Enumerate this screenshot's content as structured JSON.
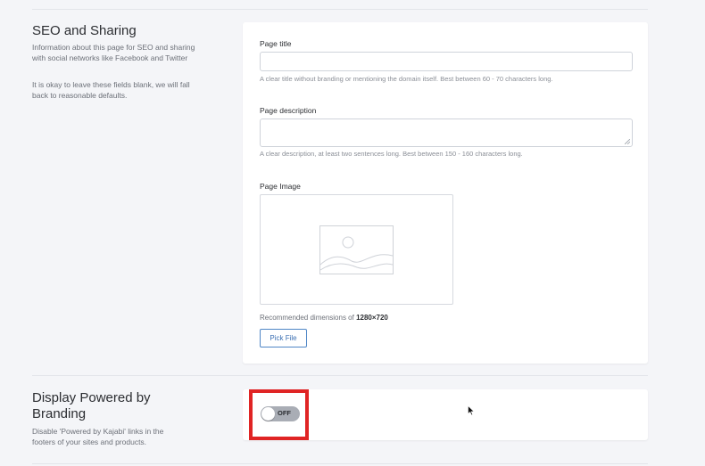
{
  "seo": {
    "title": "SEO and Sharing",
    "desc1": "Information about this page for SEO and sharing with social networks like Facebook and Twitter",
    "desc2": "It is okay to leave these fields blank, we will fall back to reasonable defaults.",
    "page_title_label": "Page title",
    "page_title_value": "",
    "page_title_help": "A clear title without branding or mentioning the domain itself. Best between 60 - 70 characters long.",
    "page_desc_label": "Page description",
    "page_desc_value": "",
    "page_desc_help": "A clear description, at least two sentences long. Best between 150 - 160 characters long.",
    "page_image_label": "Page Image",
    "recommended_prefix": "Recommended dimensions of ",
    "recommended_dims": "1280×720",
    "pick_file_label": "Pick File"
  },
  "branding": {
    "title": "Display Powered by Branding",
    "desc": "Disable 'Powered by Kajabi' links in the footers of your sites and products.",
    "toggle_label": "OFF",
    "toggle_on": false
  },
  "colors": {
    "background": "#f4f5f8",
    "card": "#ffffff",
    "accent": "#3c70b3",
    "highlight": "#e02424"
  },
  "icons": [
    "image-placeholder-icon",
    "resize-handle-icon",
    "mouse-cursor-icon"
  ]
}
